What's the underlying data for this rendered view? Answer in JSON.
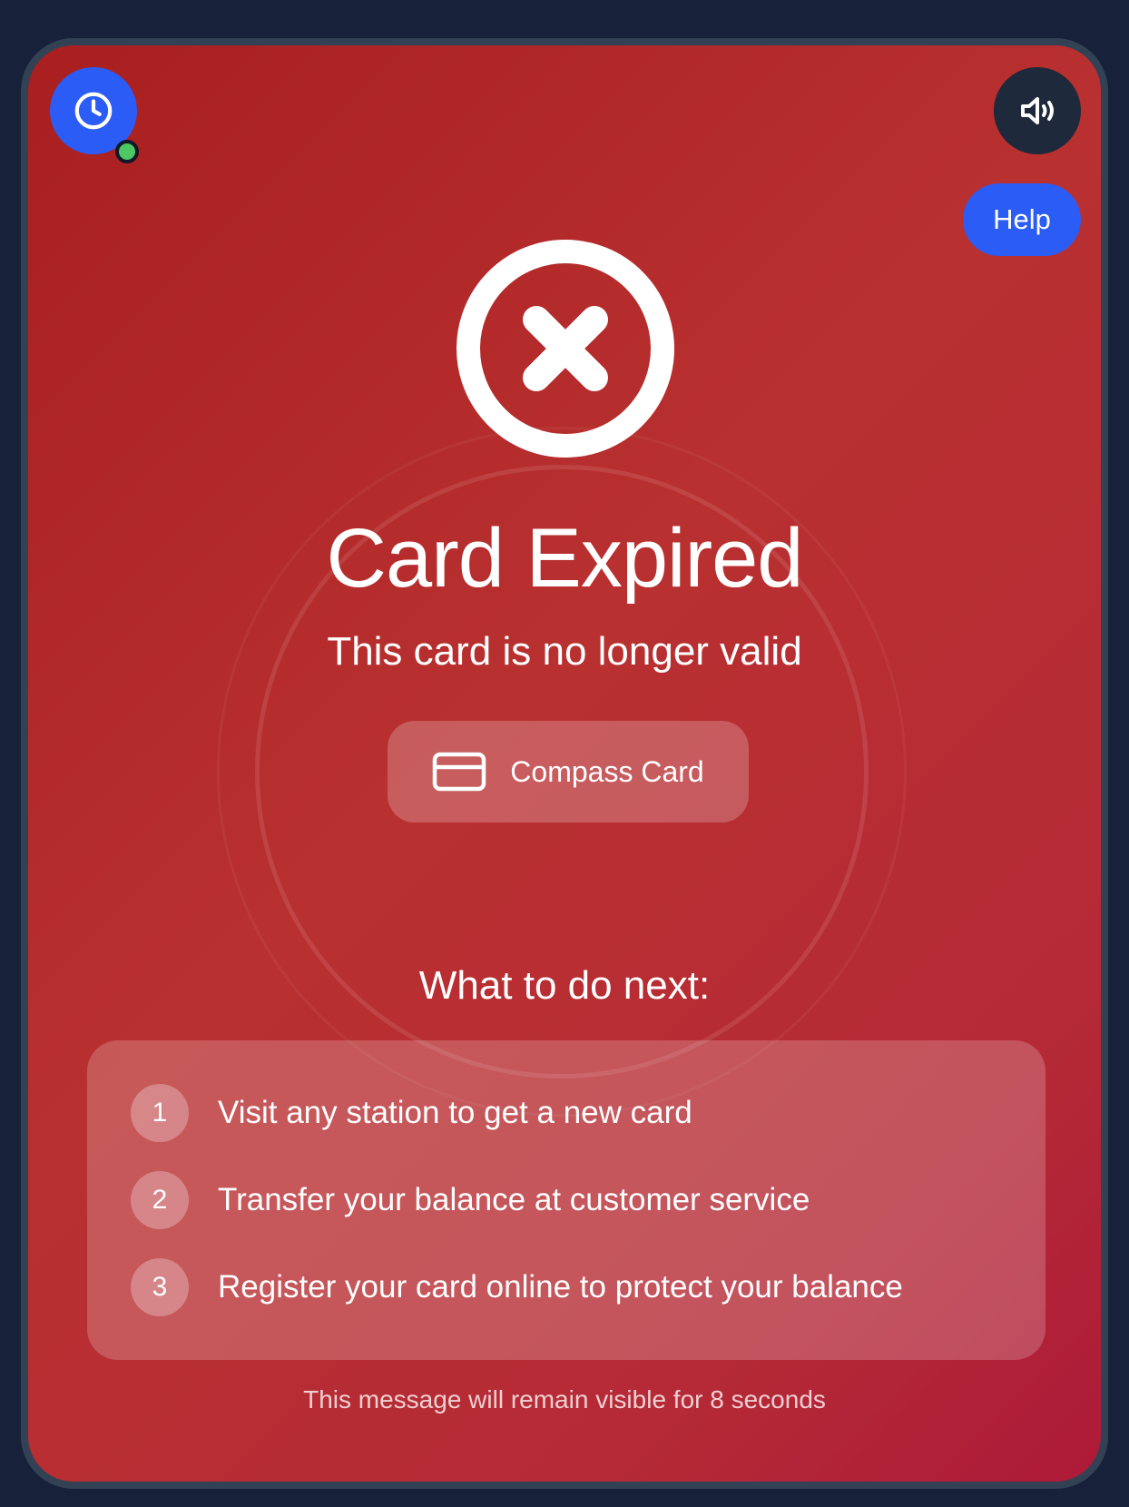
{
  "header": {
    "clock_icon": "clock-icon",
    "sound_icon": "speaker-volume-icon",
    "help_label": "Help",
    "status_color": "#4cc764"
  },
  "status": {
    "icon": "x-circle-icon",
    "title": "Card Expired",
    "subtitle": "This card is no longer valid"
  },
  "card": {
    "icon": "credit-card-icon",
    "name": "Compass Card"
  },
  "next_steps": {
    "heading": "What to do next:",
    "items": [
      {
        "number": "1",
        "text": "Visit any station to get a new card"
      },
      {
        "number": "2",
        "text": "Transfer your balance at customer service"
      },
      {
        "number": "3",
        "text": "Register your card online to protect your balance"
      }
    ]
  },
  "footer": {
    "note": "This message will remain visible for 8 seconds"
  },
  "colors": {
    "background": "#17213a",
    "accent_blue": "#2b5cf5",
    "error_red": "#b52a2a"
  }
}
